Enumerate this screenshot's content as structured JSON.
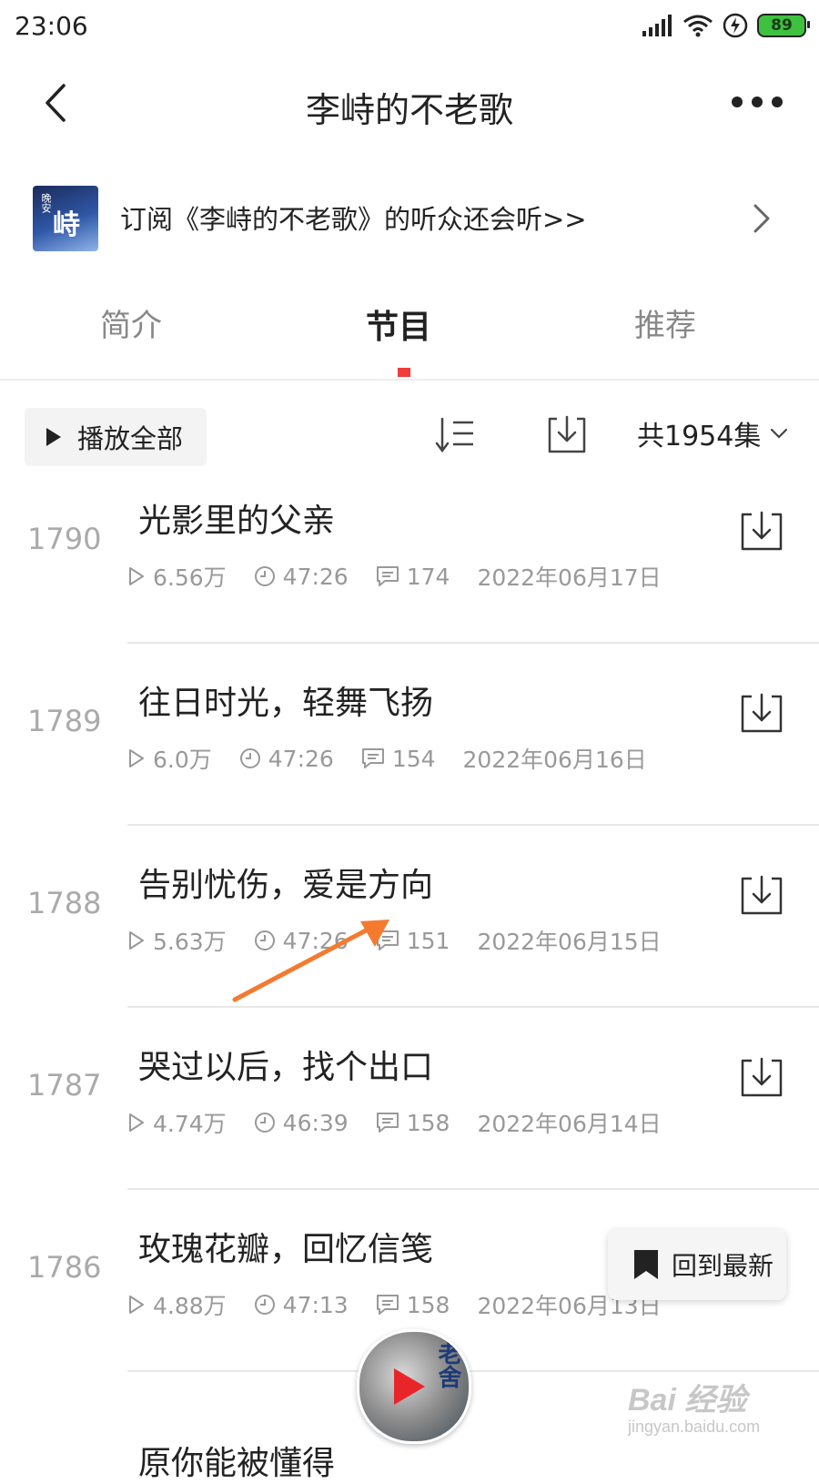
{
  "status_bar": {
    "time": "23:06",
    "battery": "89"
  },
  "header": {
    "title": "李峙的不老歌"
  },
  "banner": {
    "text": "订阅《李峙的不老歌》的听众还会听>>",
    "cover_text_top": "晚安",
    "cover_text_main": "峙"
  },
  "tabs": [
    {
      "label": "简介",
      "active": false
    },
    {
      "label": "节目",
      "active": true
    },
    {
      "label": "推荐",
      "active": false
    }
  ],
  "toolbar": {
    "play_all_label": "播放全部",
    "count_label": "共1954集"
  },
  "episodes": [
    {
      "number": "1790",
      "title": "光影里的父亲",
      "plays": "6.56万",
      "duration": "47:26",
      "comments": "174",
      "date": "2022年06月17日"
    },
    {
      "number": "1789",
      "title": "往日时光，轻舞飞扬",
      "plays": "6.0万",
      "duration": "47:26",
      "comments": "154",
      "date": "2022年06月16日"
    },
    {
      "number": "1788",
      "title": "告别忧伤，爱是方向",
      "plays": "5.63万",
      "duration": "47:26",
      "comments": "151",
      "date": "2022年06月15日"
    },
    {
      "number": "1787",
      "title": "哭过以后，找个出口",
      "plays": "4.74万",
      "duration": "46:39",
      "comments": "158",
      "date": "2022年06月14日"
    },
    {
      "number": "1786",
      "title": "玫瑰花瓣，回忆信笺",
      "plays": "4.88万",
      "duration": "47:13",
      "comments": "158",
      "date": "2022年06月13日"
    }
  ],
  "partial_episode_title": "原你能被懂得",
  "floating": {
    "back_to_latest_label": "回到最新"
  },
  "mini_player": {
    "cover_text": "老舍"
  },
  "watermark": {
    "main": "Bai 经验",
    "sub": "jingyan.baidu.com"
  },
  "colors": {
    "accent": "#f03c3c",
    "annotation_arrow": "#f47a30"
  }
}
